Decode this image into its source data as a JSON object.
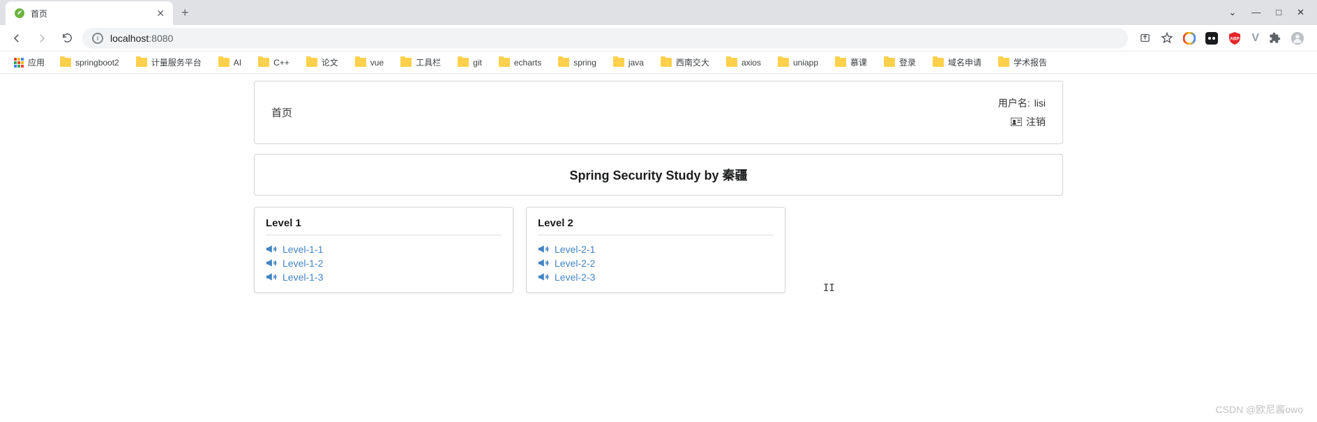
{
  "browser": {
    "tab_title": "首页",
    "url_host": "localhost",
    "url_port": ":8080",
    "apps_label": "应用",
    "bookmarks": [
      "springboot2",
      "计量服务平台",
      "AI",
      "C++",
      "论文",
      "vue",
      "工具栏",
      "git",
      "echarts",
      "spring",
      "java",
      "西南交大",
      "axios",
      "uniapp",
      "慕课",
      "登录",
      "域名申请",
      "学术报告"
    ]
  },
  "page": {
    "home_label": "首页",
    "user_prefix": "用户名:",
    "username": "lisi",
    "logout": "注销",
    "title": "Spring Security Study by 秦疆",
    "levels": [
      {
        "title": "Level 1",
        "links": [
          "Level-1-1",
          "Level-1-2",
          "Level-1-3"
        ]
      },
      {
        "title": "Level 2",
        "links": [
          "Level-2-1",
          "Level-2-2",
          "Level-2-3"
        ]
      }
    ]
  },
  "watermark": "CSDN @欧尼酱owo"
}
